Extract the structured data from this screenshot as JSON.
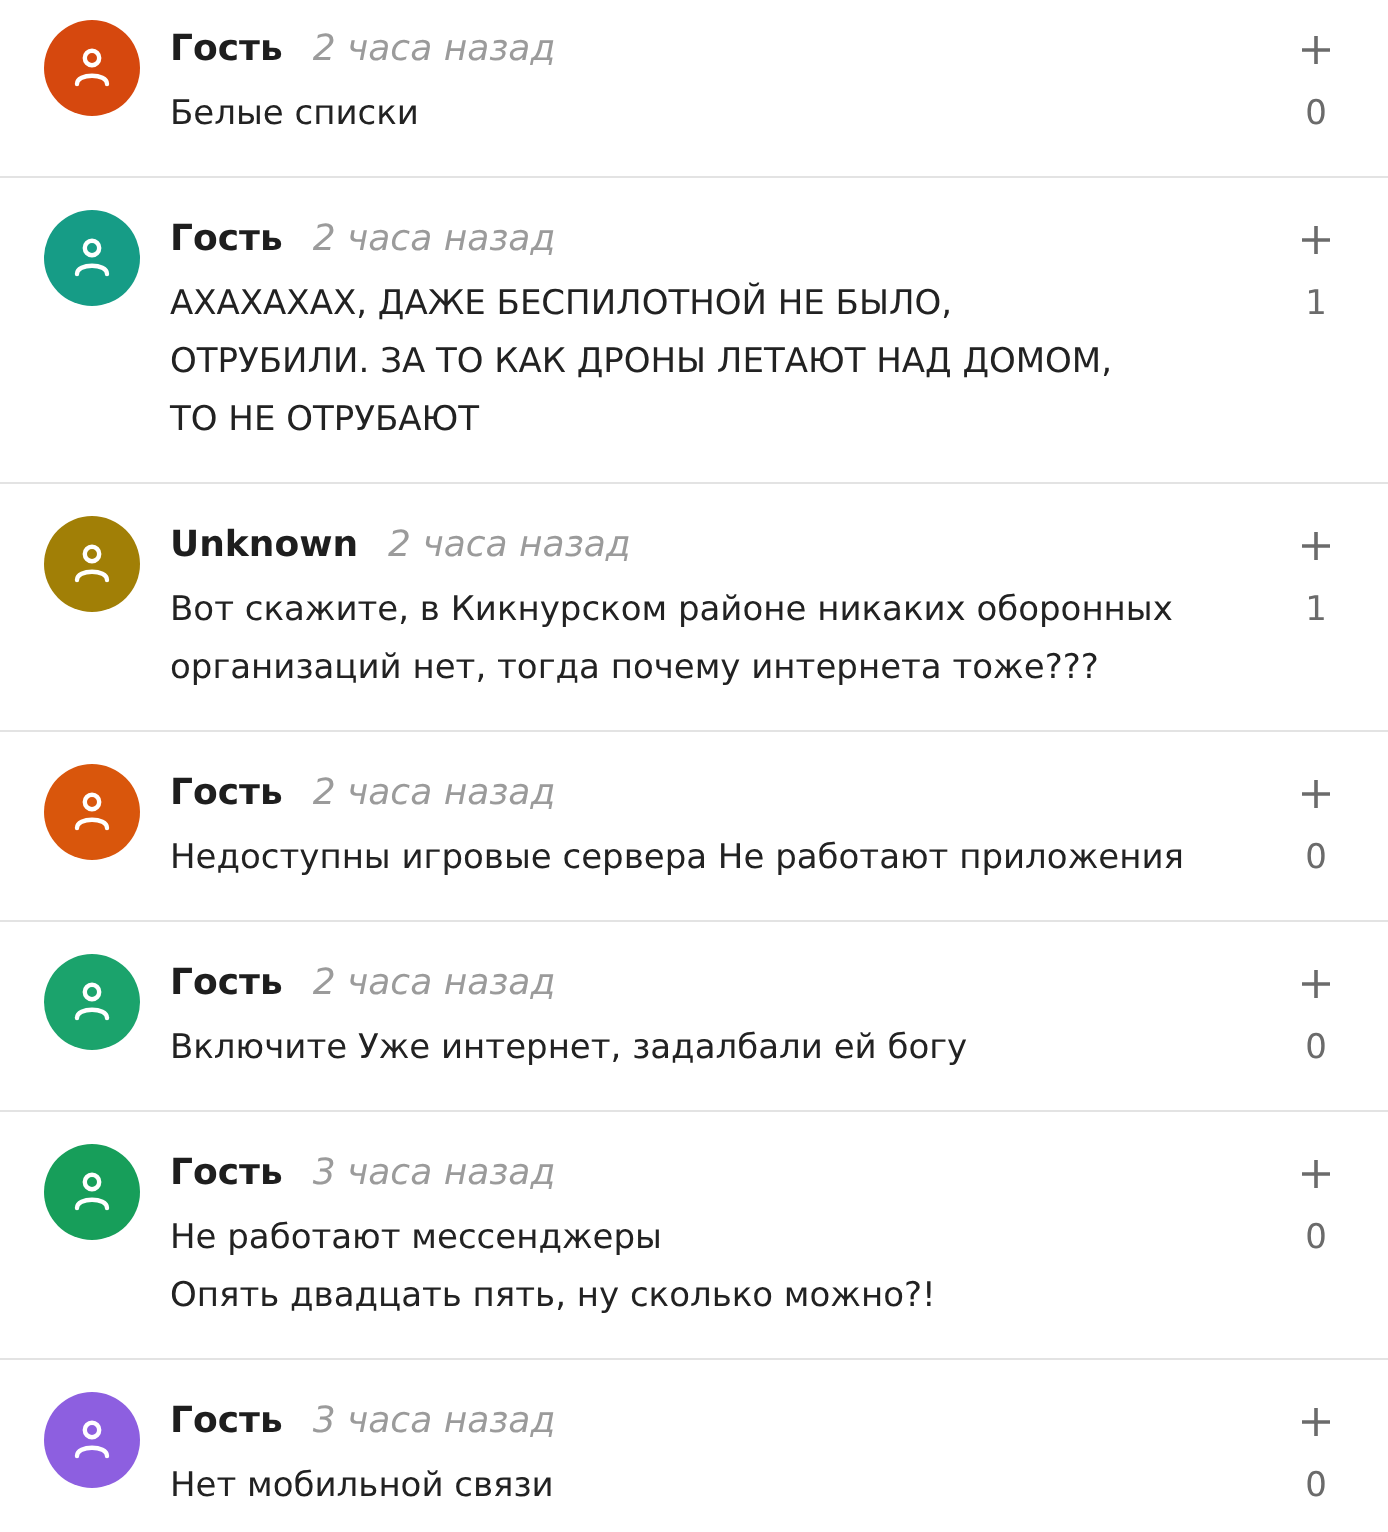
{
  "comments": [
    {
      "author": "Гость",
      "time": "2 часа назад",
      "color": "#d6480e",
      "lines": [
        "Белые списки"
      ],
      "votes": "0"
    },
    {
      "author": "Гость",
      "time": "2 часа назад",
      "color": "#169c86",
      "lines": [
        "АХАХАХАХ, ДАЖЕ БЕСПИЛОТНОЙ НЕ БЫЛО,",
        "ОТРУБИЛИ. ЗА ТО КАК ДРОНЫ ЛЕТАЮТ НАД ДОМОМ,",
        "ТО НЕ ОТРУБАЮТ"
      ],
      "votes": "1"
    },
    {
      "author": "Unknown",
      "time": "2 часа назад",
      "color": "#a17f06",
      "lines": [
        "Вот скажите, в Кикнурском районе никаких оборонных",
        "организаций нет, тогда почему интернета тоже???"
      ],
      "votes": "1"
    },
    {
      "author": "Гость",
      "time": "2 часа назад",
      "color": "#d9560c",
      "lines": [
        "Недоступны игровые сервера Не работают приложения"
      ],
      "votes": "0"
    },
    {
      "author": "Гость",
      "time": "2 часа назад",
      "color": "#1ba36c",
      "lines": [
        "Включите Уже интернет, задалбали ей богу"
      ],
      "votes": "0"
    },
    {
      "author": "Гость",
      "time": "3 часа назад",
      "color": "#179e5a",
      "lines": [
        "Не работают мессенджеры",
        "Опять двадцать пять, ну сколько можно?!"
      ],
      "votes": "0"
    },
    {
      "author": "Гость",
      "time": "3 часа назад",
      "color": "#8d5fe0",
      "lines": [
        "Нет мобильной связи"
      ],
      "votes": "0"
    }
  ]
}
